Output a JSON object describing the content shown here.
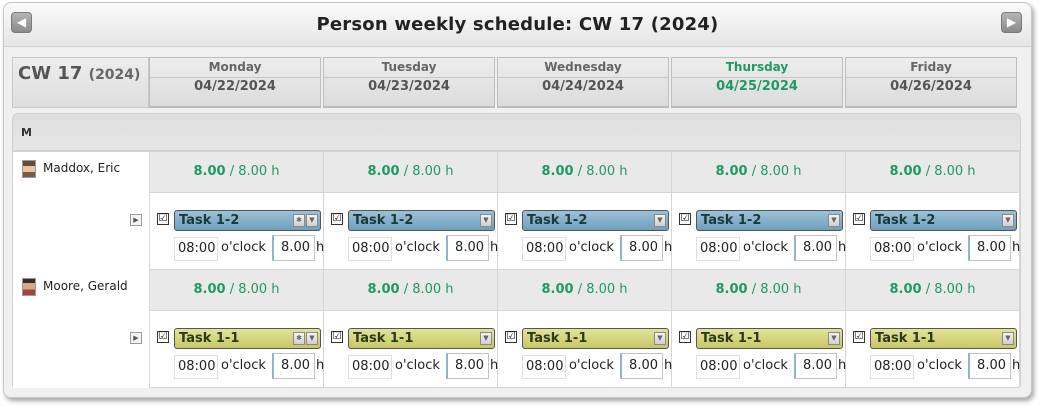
{
  "title": "Person weekly schedule:  CW 17 (2024)",
  "nav": {
    "prev_icon": "arrow-left-icon",
    "next_icon": "arrow-right-icon",
    "prev_glyph": "◀",
    "next_glyph": "▶"
  },
  "week": {
    "label": "CW 17",
    "year": "(2024)"
  },
  "days": [
    {
      "name": "Monday",
      "date": "04/22/2024"
    },
    {
      "name": "Tuesday",
      "date": "04/23/2024"
    },
    {
      "name": "Wednesday",
      "date": "04/24/2024"
    },
    {
      "name": "Thursday",
      "date": "04/25/2024"
    },
    {
      "name": "Friday",
      "date": "04/26/2024"
    }
  ],
  "today_color": "#1f9a63",
  "group": {
    "label": "M"
  },
  "persons": [
    {
      "name": "Maddox, Eric",
      "summary": {
        "planned": "8.00",
        "capacity": "/ 8.00 h"
      },
      "task": {
        "name": "Task 1-2",
        "color": "blue",
        "checked": "☑",
        "time": "08:00",
        "oclock": "o'clock",
        "hours": "8.00",
        "unit": "h"
      }
    },
    {
      "name": "Moore, Gerald",
      "summary": {
        "planned": "8.00",
        "capacity": "/ 8.00 h"
      },
      "task": {
        "name": "Task 1-1",
        "color": "yellow",
        "checked": "☑",
        "time": "08:00",
        "oclock": "o'clock",
        "hours": "8.00",
        "unit": "h"
      }
    }
  ]
}
